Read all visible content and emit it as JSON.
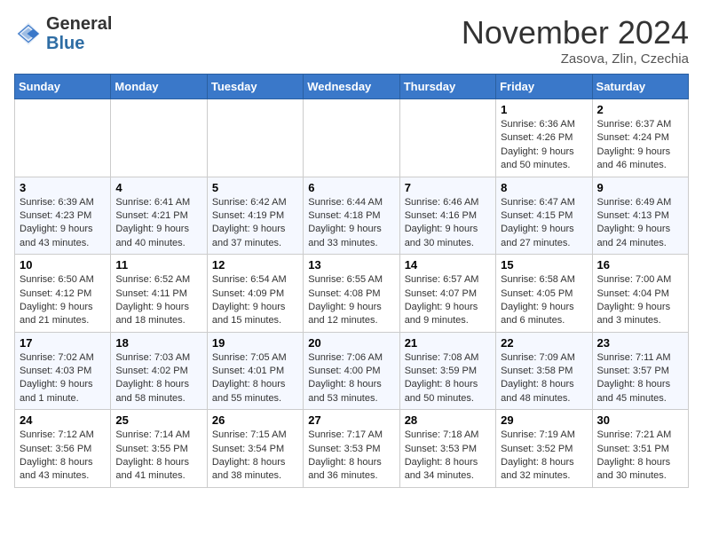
{
  "header": {
    "logo_general": "General",
    "logo_blue": "Blue",
    "month_title": "November 2024",
    "subtitle": "Zasova, Zlin, Czechia"
  },
  "weekdays": [
    "Sunday",
    "Monday",
    "Tuesday",
    "Wednesday",
    "Thursday",
    "Friday",
    "Saturday"
  ],
  "weeks": [
    [
      {
        "day": "",
        "info": ""
      },
      {
        "day": "",
        "info": ""
      },
      {
        "day": "",
        "info": ""
      },
      {
        "day": "",
        "info": ""
      },
      {
        "day": "",
        "info": ""
      },
      {
        "day": "1",
        "info": "Sunrise: 6:36 AM\nSunset: 4:26 PM\nDaylight: 9 hours and 50 minutes."
      },
      {
        "day": "2",
        "info": "Sunrise: 6:37 AM\nSunset: 4:24 PM\nDaylight: 9 hours and 46 minutes."
      }
    ],
    [
      {
        "day": "3",
        "info": "Sunrise: 6:39 AM\nSunset: 4:23 PM\nDaylight: 9 hours and 43 minutes."
      },
      {
        "day": "4",
        "info": "Sunrise: 6:41 AM\nSunset: 4:21 PM\nDaylight: 9 hours and 40 minutes."
      },
      {
        "day": "5",
        "info": "Sunrise: 6:42 AM\nSunset: 4:19 PM\nDaylight: 9 hours and 37 minutes."
      },
      {
        "day": "6",
        "info": "Sunrise: 6:44 AM\nSunset: 4:18 PM\nDaylight: 9 hours and 33 minutes."
      },
      {
        "day": "7",
        "info": "Sunrise: 6:46 AM\nSunset: 4:16 PM\nDaylight: 9 hours and 30 minutes."
      },
      {
        "day": "8",
        "info": "Sunrise: 6:47 AM\nSunset: 4:15 PM\nDaylight: 9 hours and 27 minutes."
      },
      {
        "day": "9",
        "info": "Sunrise: 6:49 AM\nSunset: 4:13 PM\nDaylight: 9 hours and 24 minutes."
      }
    ],
    [
      {
        "day": "10",
        "info": "Sunrise: 6:50 AM\nSunset: 4:12 PM\nDaylight: 9 hours and 21 minutes."
      },
      {
        "day": "11",
        "info": "Sunrise: 6:52 AM\nSunset: 4:11 PM\nDaylight: 9 hours and 18 minutes."
      },
      {
        "day": "12",
        "info": "Sunrise: 6:54 AM\nSunset: 4:09 PM\nDaylight: 9 hours and 15 minutes."
      },
      {
        "day": "13",
        "info": "Sunrise: 6:55 AM\nSunset: 4:08 PM\nDaylight: 9 hours and 12 minutes."
      },
      {
        "day": "14",
        "info": "Sunrise: 6:57 AM\nSunset: 4:07 PM\nDaylight: 9 hours and 9 minutes."
      },
      {
        "day": "15",
        "info": "Sunrise: 6:58 AM\nSunset: 4:05 PM\nDaylight: 9 hours and 6 minutes."
      },
      {
        "day": "16",
        "info": "Sunrise: 7:00 AM\nSunset: 4:04 PM\nDaylight: 9 hours and 3 minutes."
      }
    ],
    [
      {
        "day": "17",
        "info": "Sunrise: 7:02 AM\nSunset: 4:03 PM\nDaylight: 9 hours and 1 minute."
      },
      {
        "day": "18",
        "info": "Sunrise: 7:03 AM\nSunset: 4:02 PM\nDaylight: 8 hours and 58 minutes."
      },
      {
        "day": "19",
        "info": "Sunrise: 7:05 AM\nSunset: 4:01 PM\nDaylight: 8 hours and 55 minutes."
      },
      {
        "day": "20",
        "info": "Sunrise: 7:06 AM\nSunset: 4:00 PM\nDaylight: 8 hours and 53 minutes."
      },
      {
        "day": "21",
        "info": "Sunrise: 7:08 AM\nSunset: 3:59 PM\nDaylight: 8 hours and 50 minutes."
      },
      {
        "day": "22",
        "info": "Sunrise: 7:09 AM\nSunset: 3:58 PM\nDaylight: 8 hours and 48 minutes."
      },
      {
        "day": "23",
        "info": "Sunrise: 7:11 AM\nSunset: 3:57 PM\nDaylight: 8 hours and 45 minutes."
      }
    ],
    [
      {
        "day": "24",
        "info": "Sunrise: 7:12 AM\nSunset: 3:56 PM\nDaylight: 8 hours and 43 minutes."
      },
      {
        "day": "25",
        "info": "Sunrise: 7:14 AM\nSunset: 3:55 PM\nDaylight: 8 hours and 41 minutes."
      },
      {
        "day": "26",
        "info": "Sunrise: 7:15 AM\nSunset: 3:54 PM\nDaylight: 8 hours and 38 minutes."
      },
      {
        "day": "27",
        "info": "Sunrise: 7:17 AM\nSunset: 3:53 PM\nDaylight: 8 hours and 36 minutes."
      },
      {
        "day": "28",
        "info": "Sunrise: 7:18 AM\nSunset: 3:53 PM\nDaylight: 8 hours and 34 minutes."
      },
      {
        "day": "29",
        "info": "Sunrise: 7:19 AM\nSunset: 3:52 PM\nDaylight: 8 hours and 32 minutes."
      },
      {
        "day": "30",
        "info": "Sunrise: 7:21 AM\nSunset: 3:51 PM\nDaylight: 8 hours and 30 minutes."
      }
    ]
  ]
}
